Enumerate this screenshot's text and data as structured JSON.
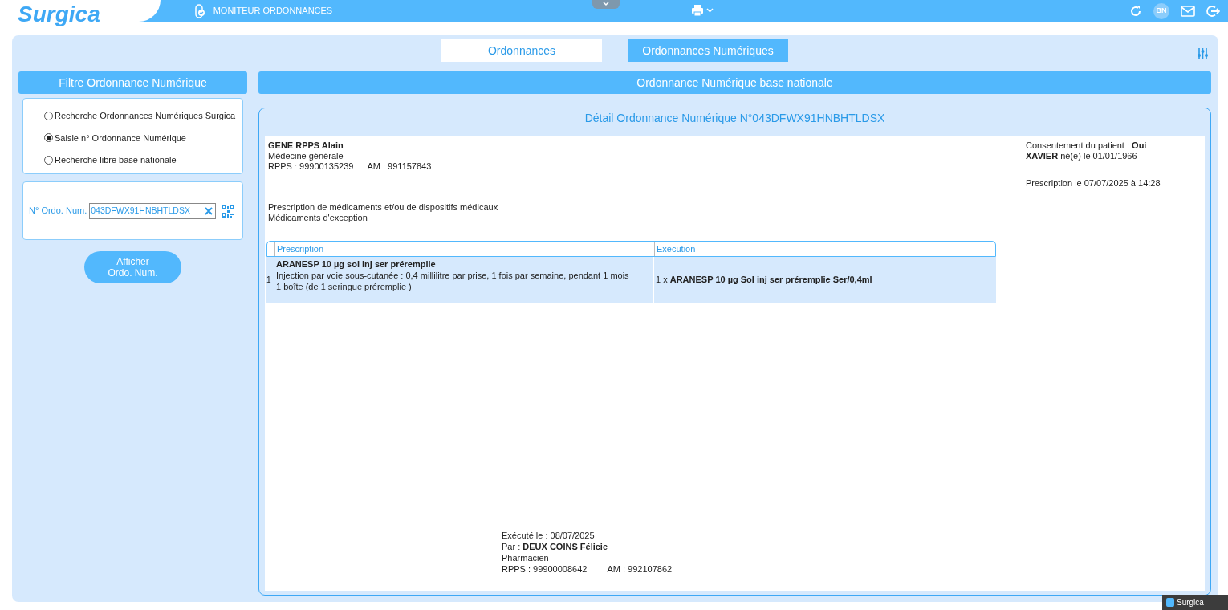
{
  "header": {
    "logo": "Surgica",
    "module_title": "MONITEUR ORDONNANCES",
    "avatar_initials": "BN"
  },
  "tabs": [
    {
      "label": "Ordonnances",
      "selected": false
    },
    {
      "label": "Ordonnances Numériques",
      "selected": true
    }
  ],
  "filter": {
    "title": "Filtre Ordonnance Numérique",
    "options": [
      {
        "label": "Recherche Ordonnances Numériques Surgica",
        "selected": false
      },
      {
        "label": "Saisie n° Ordonnance Numérique",
        "selected": true
      },
      {
        "label": "Recherche libre base nationale",
        "selected": false
      }
    ],
    "field": {
      "label": "N° Ordo. Num.",
      "value": "043DFWX91HNBHTLDSX"
    },
    "button": [
      "Afficher",
      "Ordo. Num."
    ]
  },
  "main": {
    "title": "Ordonnance Numérique base nationale",
    "detail": {
      "title": "Détail Ordonnance Numérique N°043DFWX91HNBHTLDSX",
      "prescriber": {
        "name": "GENE RPPS Alain",
        "specialty": "Médecine générale",
        "rpps": "RPPS : 99900135239",
        "am": "AM : 991157843"
      },
      "consent": "Consentement du patient : **Oui**",
      "patient": "**XAVIER**  né(e) le 01/01/1966",
      "prescription_date": "Prescription le 07/07/2025 à 14:28",
      "types": [
        "Prescription de médicaments et/ou de dispositifs médicaux",
        "Médicaments d'exception"
      ],
      "table": {
        "columns": [
          "Prescription",
          "Exécution"
        ],
        "rows": [
          {
            "number": "1",
            "prescription_title": "ARANESP 10 µg sol inj ser préremplie",
            "prescription_lines": [
              "Injection par voie sous-cutanée : 0,4 millilitre par prise, 1 fois par semaine, pendant 1 mois",
              "1 boîte  (de 1 seringue préremplie )"
            ],
            "execution": "1 x **ARANESP 10 µg Sol inj ser préremplie Ser/0,4ml**",
            "selected": true
          }
        ]
      },
      "executed": {
        "date": "Exécuté le : 08/07/2025",
        "by": "Par : **DEUX COINS Félicie**",
        "role": "Pharmacien",
        "rpps": "RPPS : 99900008642",
        "am": "AM : 992107862"
      }
    }
  },
  "taskbar": {
    "label": "Surgica"
  }
}
